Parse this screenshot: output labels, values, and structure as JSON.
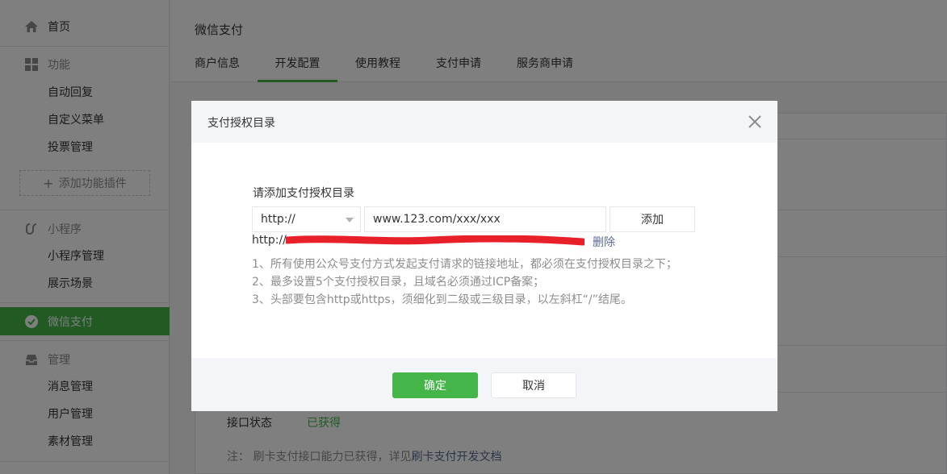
{
  "sidebar": {
    "home": "首页",
    "function_group": "功能",
    "function_items": [
      "自动回复",
      "自定义菜单",
      "投票管理"
    ],
    "add_plugin": "添加功能插件",
    "miniprogram_group": "小程序",
    "miniprogram_items": [
      "小程序管理",
      "展示场景"
    ],
    "wechat_pay": "微信支付",
    "manage_group": "管理",
    "manage_items": [
      "消息管理",
      "用户管理",
      "素材管理"
    ]
  },
  "main": {
    "title": "微信支付",
    "tabs": [
      {
        "label": "商户信息",
        "active": false
      },
      {
        "label": "开发配置",
        "active": true
      },
      {
        "label": "使用教程",
        "active": false
      },
      {
        "label": "支付申请",
        "active": false
      },
      {
        "label": "服务商申请",
        "active": false
      }
    ],
    "bottom": {
      "status_label": "接口状态",
      "status_value": "已获得",
      "note_prefix": "注：  刷卡支付接口能力已获得，详见",
      "note_link": "刷卡支付开发文档"
    }
  },
  "dialog": {
    "title": "支付授权目录",
    "field_label": "请添加支付授权目录",
    "protocol_value": "http://",
    "url_value": "www.123.com/xxx/xxx",
    "add_label": "添加",
    "dir_prefix": "http://w",
    "dir_suffix": "/",
    "delete_label": "删除",
    "tips": [
      "1、所有使用公众号支付方式发起支付请求的链接地址，都必须在支付授权目录之下；",
      "2、最多设置5个支付授权目录，且域名必须通过ICP备案；",
      "3、头部要包含http或https，须细化到二级或三级目录，以左斜杠“/”结尾。"
    ],
    "ok_label": "确定",
    "cancel_label": "取消"
  },
  "colors": {
    "accent": "#44b549",
    "link": "#576b95",
    "redact": "#e8202a",
    "mask": "#000000"
  }
}
